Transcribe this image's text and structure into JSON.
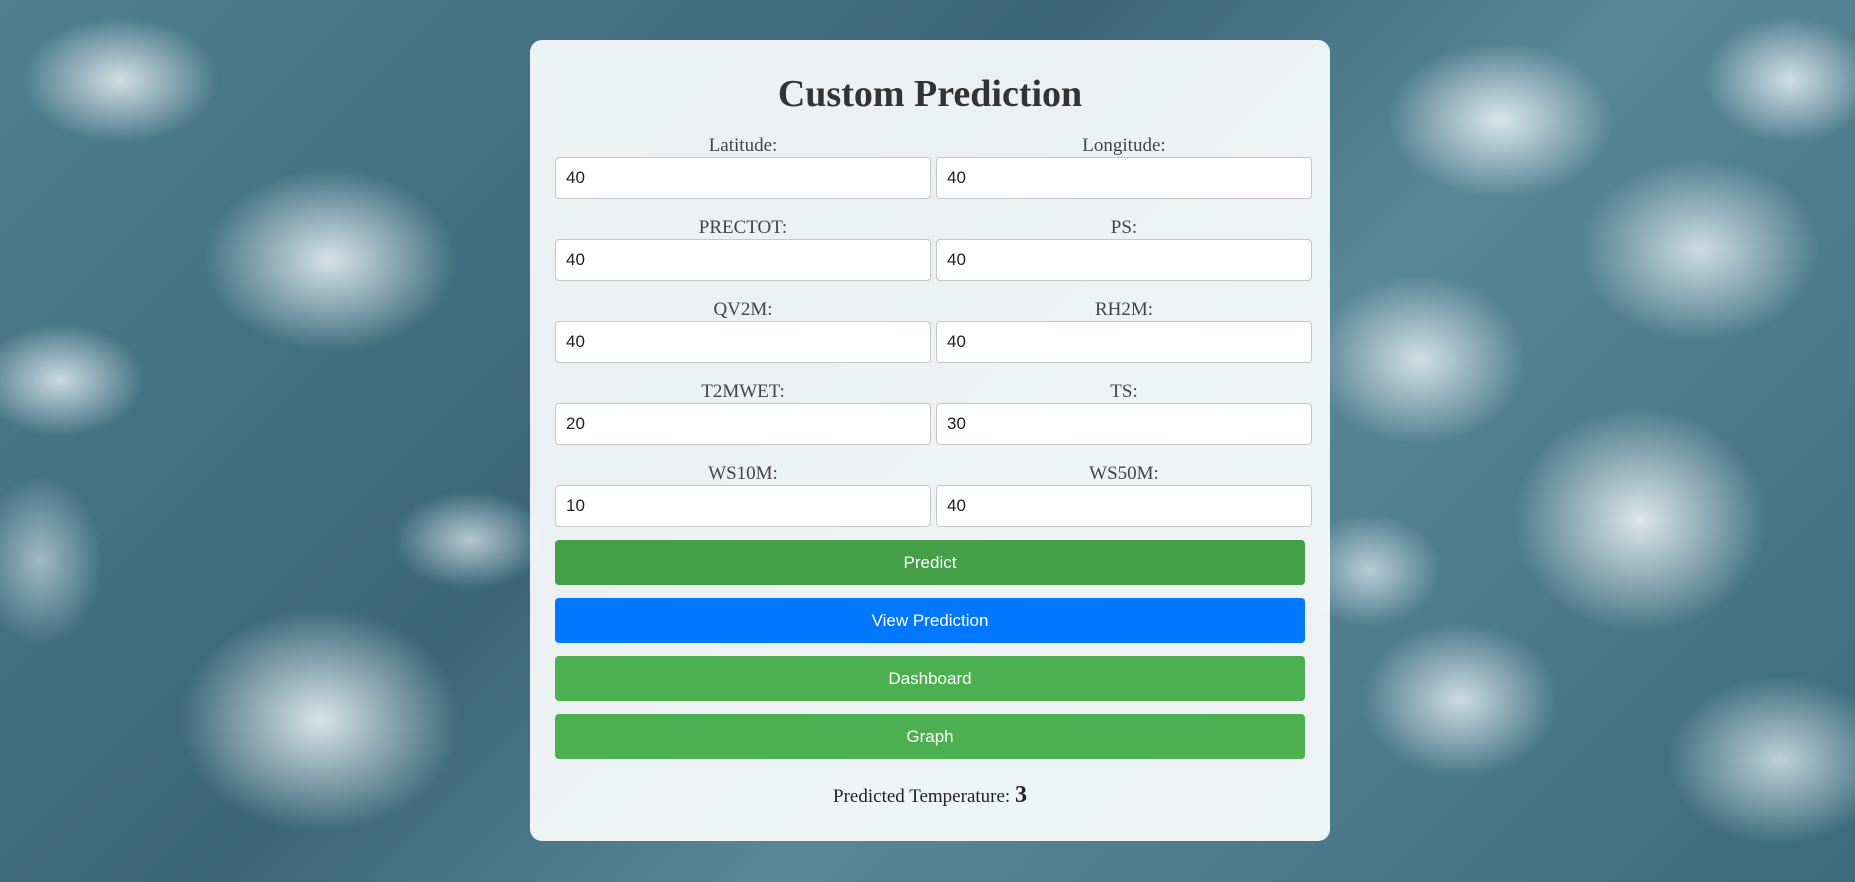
{
  "page": {
    "title": "Custom Prediction"
  },
  "fields": {
    "latitude": {
      "label": "Latitude:",
      "value": "40"
    },
    "longitude": {
      "label": "Longitude:",
      "value": "40"
    },
    "prectot": {
      "label": "PRECTOT:",
      "value": "40"
    },
    "ps": {
      "label": "PS:",
      "value": "40"
    },
    "qv2m": {
      "label": "QV2M:",
      "value": "40"
    },
    "rh2m": {
      "label": "RH2M:",
      "value": "40"
    },
    "t2mwet": {
      "label": "T2MWET:",
      "value": "20"
    },
    "ts": {
      "label": "TS:",
      "value": "30"
    },
    "ws10m": {
      "label": "WS10M:",
      "value": "10"
    },
    "ws50m": {
      "label": "WS50M:",
      "value": "40"
    }
  },
  "buttons": {
    "predict": {
      "label": "Predict",
      "color": "#43a047"
    },
    "view": {
      "label": "View Prediction",
      "color": "#0077ff"
    },
    "dashboard": {
      "label": "Dashboard",
      "color": "#4caf50"
    },
    "graph": {
      "label": "Graph",
      "color": "#4caf50"
    }
  },
  "result": {
    "label": "Predicted Temperature:",
    "value": "3"
  }
}
